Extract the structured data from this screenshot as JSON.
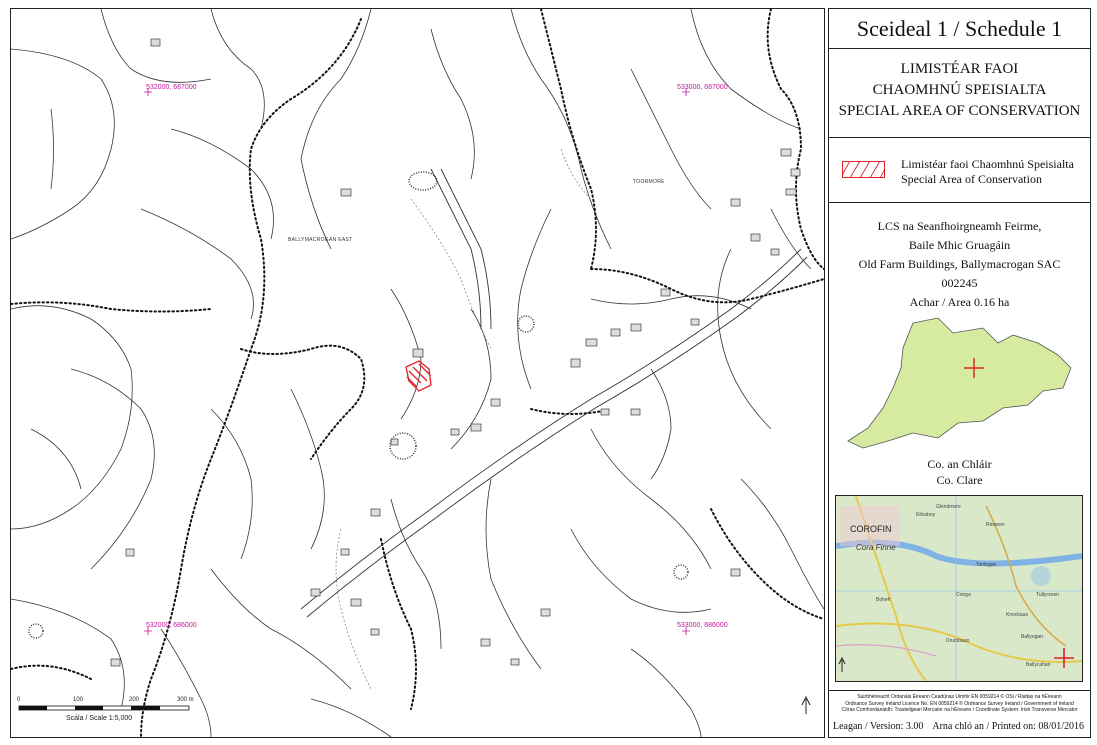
{
  "panel": {
    "title": "Sceideal 1 / Schedule 1",
    "area_type_ga_1": "LIMISTÉAR FAOI",
    "area_type_ga_2": "CHAOMHNÚ SPEISIALTA",
    "area_type_en": "SPECIAL AREA OF CONSERVATION",
    "legend_ga": "Limistéar faoi Chaomhnú Speisialta",
    "legend_en": "Special Area of Conservation",
    "site_name_ga_1": "LCS na Seanfhoirgneamh Feirme,",
    "site_name_ga_2": "Baile Mhic Gruagáin",
    "site_name_en": "Old Farm Buildings, Ballymacrogan SAC",
    "site_code": "002245",
    "area": "Achar / Area 0.16 ha",
    "county_ga": "Co. an Chláir",
    "county_en": "Co. Clare",
    "credit_1": "Suirbhéireacht Ordanáis Éireann Ceadúnas Uimhir EN 0059214 © OSi / Rialtas na hÉireann",
    "credit_2": "Ordnance Survey Ireland Licence No. EN 0059214 © Ordnance Survey Ireland / Government of Ireland",
    "credit_3": "Córas Comhordanáidh: Trasteilgean Mercator na hÉireann / Coordinate System: Irish Transverse Mercator",
    "version": "Leagan / Version: 3.00",
    "printed": "Arna chló an / Printed on: 08/01/2016"
  },
  "map": {
    "coords": [
      "532000, 687000",
      "533000, 687000",
      "532000, 686000",
      "533000, 686000"
    ],
    "places": [
      "BALLYMACROGAN EAST",
      "TOORMORE"
    ],
    "scale_label": "Scála / Scale 1:5,000",
    "scale_ticks": [
      "0",
      "100",
      "200",
      "300 m"
    ],
    "site_color": "#e0202a",
    "coord_color": "#c2179a"
  },
  "inset": {
    "labels": [
      "COROFIN",
      "Cora Finne",
      "Kilnaboy",
      "Rinneen",
      "Glendmore",
      "Tonlegee",
      "Ballyogan",
      "Boheh",
      "Drumbaun",
      "Cooga",
      "Tullycreen",
      "Ballycahan",
      "Knockaun"
    ]
  }
}
